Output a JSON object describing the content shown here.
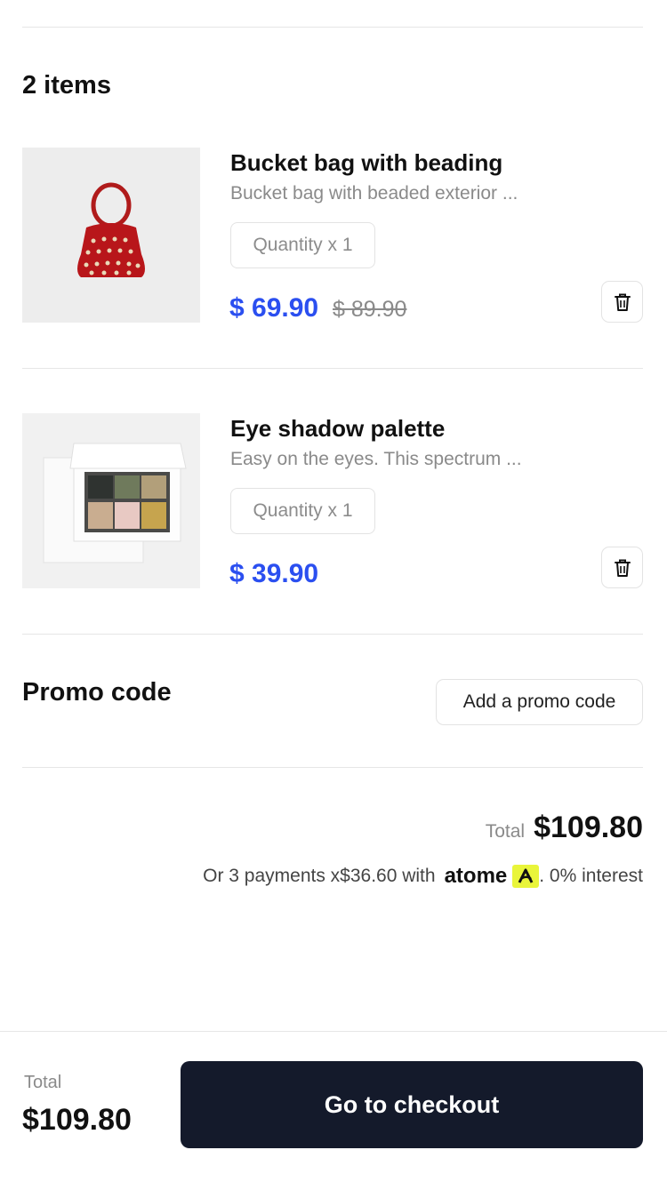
{
  "cart": {
    "items_heading": "2 items",
    "items": [
      {
        "name": "Bucket bag with beading",
        "description": "Bucket bag with beaded exterior ...",
        "quantity_label": "Quantity x 1",
        "price": "$ 69.90",
        "original_price": "$ 89.90",
        "image_icon": "red-beaded-bucket-bag"
      },
      {
        "name": "Eye shadow palette",
        "description": "Easy on the eyes. This spectrum ...",
        "quantity_label": "Quantity x 1",
        "price": "$ 39.90",
        "image_icon": "eyeshadow-palette"
      }
    ]
  },
  "promo": {
    "title": "Promo code",
    "button_label": "Add a promo code"
  },
  "summary": {
    "total_label": "Total",
    "total_value": "$109.80",
    "installment_prefix": "Or 3 payments x$36.60 with",
    "installment_brand": "atome",
    "installment_suffix": ". 0% interest"
  },
  "footer": {
    "total_label": "Total",
    "total_value": "$109.80",
    "checkout_label": "Go to checkout"
  },
  "colors": {
    "accent_price": "#2b4ff0",
    "checkout_bg": "#141a2b",
    "atome_badge": "#e9f53a"
  }
}
